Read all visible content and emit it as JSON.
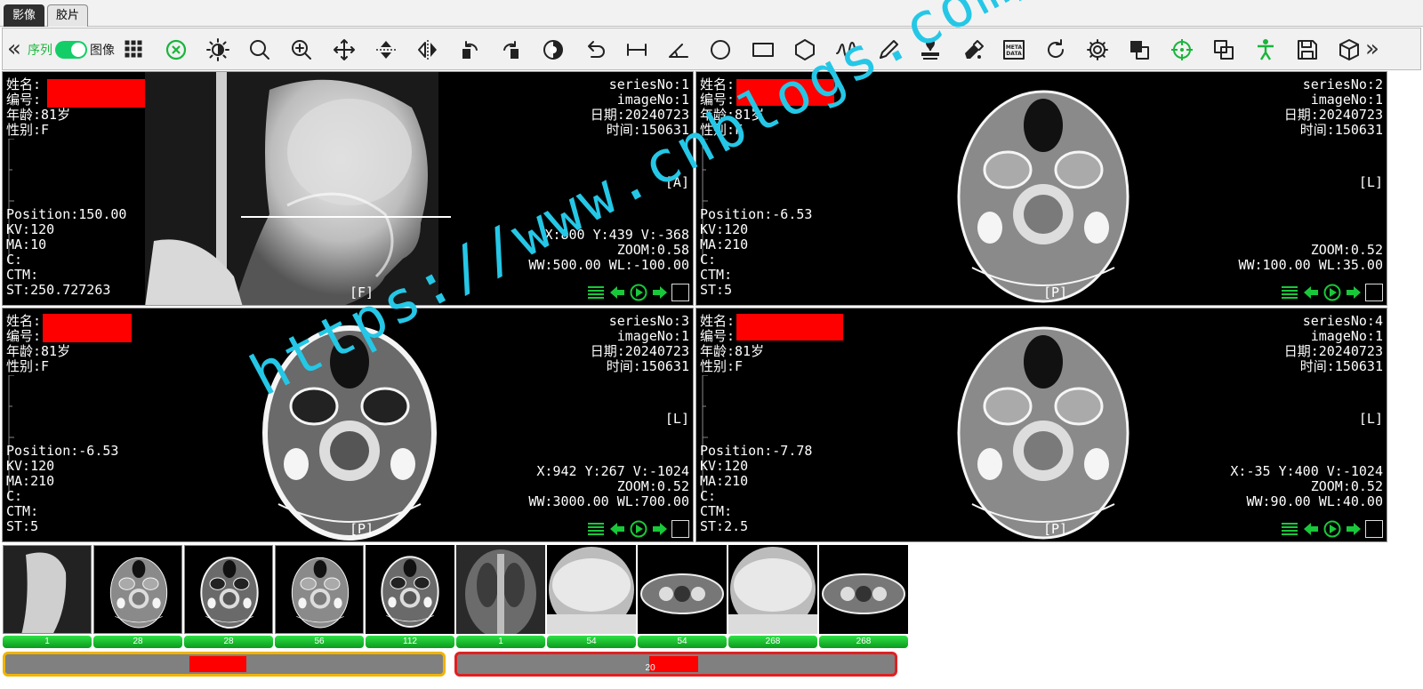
{
  "tabs": [
    "影像",
    "胶片"
  ],
  "toolbar": {
    "expand_left": "«",
    "expand_right": "»",
    "toggle_label_on": "序列",
    "toggle_label_off": "图像",
    "meta_line1": "META",
    "meta_line2": "DATA",
    "icons": [
      "layout-grid-icon",
      "reset-icon",
      "brightness-icon",
      "magnifier-icon",
      "zoom-in-icon",
      "pan-icon",
      "flip-vertical-icon",
      "flip-horizontal-icon",
      "rotate-left-icon",
      "rotate-right-icon",
      "invert-icon",
      "undo-icon",
      "length-icon",
      "angle-icon",
      "ellipse-roi-icon",
      "rectangle-roi-icon",
      "polygon-roi-icon",
      "freehand-icon",
      "pencil-icon",
      "stamp-icon",
      "eraser-icon",
      "metadata-icon",
      "refresh-icon",
      "settings-icon",
      "overlay-icon",
      "crosshair-icon",
      "compare-icon",
      "body-icon",
      "save-icon",
      "3d-cube-icon"
    ]
  },
  "viewports": [
    {
      "name_label": "姓名:",
      "id_label": "编号:",
      "age": "年龄:81岁",
      "sex": "性别:F",
      "series": "seriesNo:1",
      "image": "imageNo:1",
      "date": "日期:20240723",
      "time": "时间:150631",
      "orient_right": "[A]",
      "orient_bottom": "[F]",
      "position": "Position:150.00",
      "kv": "KV:120",
      "ma": "MA:10",
      "c": "C:",
      "ctm": "CTM:",
      "st": "ST:250.727263",
      "xyv": "X:800 Y:439 V:-368",
      "zoom": "ZOOM:0.58",
      "wwwl": "WW:500.00 WL:-100.00"
    },
    {
      "name_label": "姓名:",
      "id_label": "编号:",
      "age": "年龄:81岁",
      "sex": "性别:F",
      "series": "seriesNo:2",
      "image": "imageNo:1",
      "date": "日期:20240723",
      "time": "时间:150631",
      "orient_right": "[L]",
      "orient_bottom": "[P]",
      "position": "Position:-6.53",
      "kv": "KV:120",
      "ma": "MA:210",
      "c": "C:",
      "ctm": "CTM:",
      "st": "ST:5",
      "xyv": "",
      "zoom": "ZOOM:0.52",
      "wwwl": "WW:100.00 WL:35.00"
    },
    {
      "name_label": "姓名:",
      "id_label": "编号:",
      "age": "年龄:81岁",
      "sex": "性别:F",
      "series": "seriesNo:3",
      "image": "imageNo:1",
      "date": "日期:20240723",
      "time": "时间:150631",
      "orient_right": "[L]",
      "orient_bottom": "[P]",
      "position": "Position:-6.53",
      "kv": "KV:120",
      "ma": "MA:210",
      "c": "C:",
      "ctm": "CTM:",
      "st": "ST:5",
      "xyv": "X:942 Y:267 V:-1024",
      "zoom": "ZOOM:0.52",
      "wwwl": "WW:3000.00 WL:700.00"
    },
    {
      "name_label": "姓名:",
      "id_label": "编号:",
      "age": "年龄:81岁",
      "sex": "性别:F",
      "series": "seriesNo:4",
      "image": "imageNo:1",
      "date": "日期:20240723",
      "time": "时间:150631",
      "orient_right": "[L]",
      "orient_bottom": "[P]",
      "position": "Position:-7.78",
      "kv": "KV:120",
      "ma": "MA:210",
      "c": "C:",
      "ctm": "CTM:",
      "st": "ST:2.5",
      "xyv": "X:-35 Y:400 V:-1024",
      "zoom": "ZOOM:0.52",
      "wwwl": "WW:90.00 WL:40.00"
    }
  ],
  "thumbnails": [
    {
      "count": "1",
      "kind": "skull-lateral"
    },
    {
      "count": "28",
      "kind": "ct-head-soft"
    },
    {
      "count": "28",
      "kind": "ct-head-bone"
    },
    {
      "count": "56",
      "kind": "ct-head-soft"
    },
    {
      "count": "112",
      "kind": "ct-head-bone"
    },
    {
      "count": "1",
      "kind": "chest-ap"
    },
    {
      "count": "54",
      "kind": "ct-chest-lung"
    },
    {
      "count": "54",
      "kind": "ct-chest-soft"
    },
    {
      "count": "268",
      "kind": "ct-chest-lung"
    },
    {
      "count": "268",
      "kind": "ct-chest-soft"
    }
  ],
  "study_bars": [
    {
      "label": "",
      "border": "#f0b400",
      "fill_start": 0.42,
      "fill_end": 0.55
    },
    {
      "label": "20",
      "border": "#e02020",
      "fill_start": 0.44,
      "fill_end": 0.55
    }
  ],
  "watermark": "https://www.cnblogs.com/poxiao",
  "colors": {
    "accent_green": "#13ce66",
    "redaction": "#ff0000",
    "watermark": "#25c7e6"
  }
}
